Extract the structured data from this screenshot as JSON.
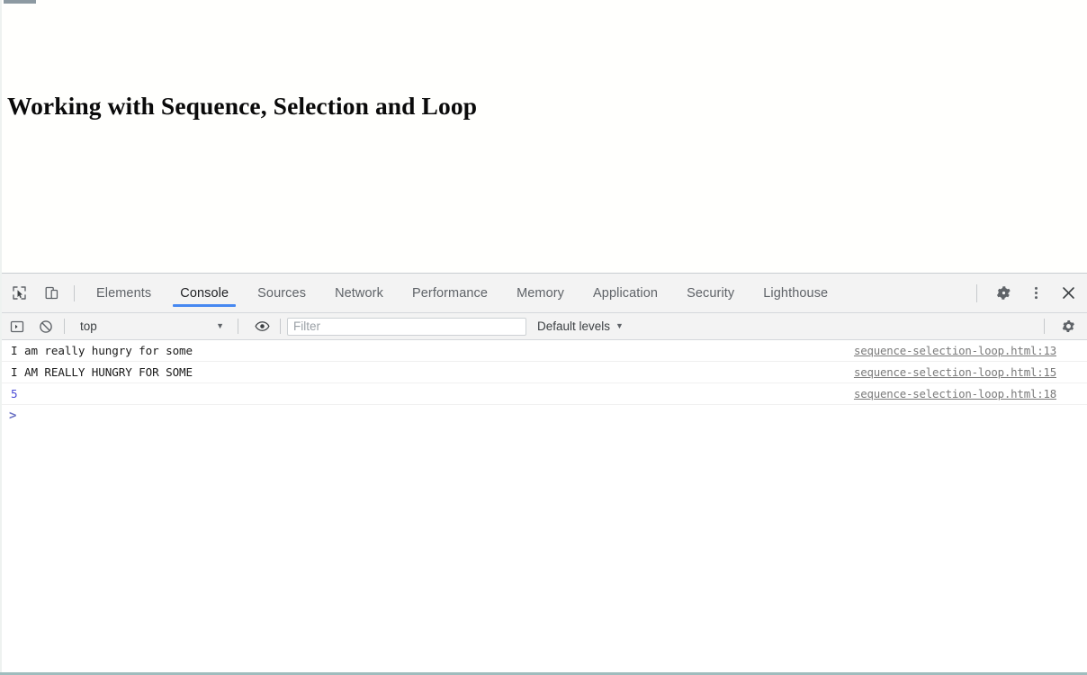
{
  "page": {
    "title": "Working with Sequence, Selection and Loop"
  },
  "devtools": {
    "tabbar": {
      "inspect_icon": "inspect-element-icon",
      "device_icon": "device-toolbar-icon",
      "tabs": [
        {
          "label": "Elements",
          "active": false
        },
        {
          "label": "Console",
          "active": true
        },
        {
          "label": "Sources",
          "active": false
        },
        {
          "label": "Network",
          "active": false
        },
        {
          "label": "Performance",
          "active": false
        },
        {
          "label": "Memory",
          "active": false
        },
        {
          "label": "Application",
          "active": false
        },
        {
          "label": "Security",
          "active": false
        },
        {
          "label": "Lighthouse",
          "active": false
        }
      ],
      "settings_icon": "gear-icon",
      "more_icon": "kebab-menu-icon",
      "close_icon": "close-icon"
    },
    "toolbar": {
      "sidebar_icon": "console-sidebar-icon",
      "clear_icon": "clear-console-icon",
      "context": "top",
      "context_caret": "▼",
      "eye_icon": "eye-icon",
      "filter_placeholder": "Filter",
      "filter_value": "",
      "levels_label": "Default levels",
      "levels_caret": "▼",
      "settings_icon": "gear-icon"
    },
    "console": {
      "messages": [
        {
          "text": "I am really hungry for some",
          "type": "log",
          "source": "sequence-selection-loop.html:13"
        },
        {
          "text": "I AM REALLY HUNGRY FOR SOME",
          "type": "log",
          "source": "sequence-selection-loop.html:15"
        },
        {
          "text": "5",
          "type": "number",
          "source": "sequence-selection-loop.html:18"
        }
      ],
      "prompt": ">",
      "prompt_value": ""
    }
  },
  "colors": {
    "accent": "#4688f1",
    "numeric": "#4a4ad6",
    "prompt": "#6b72c4",
    "toolbar_bg": "#f3f3f3",
    "source_link": "#7a7a7a"
  }
}
